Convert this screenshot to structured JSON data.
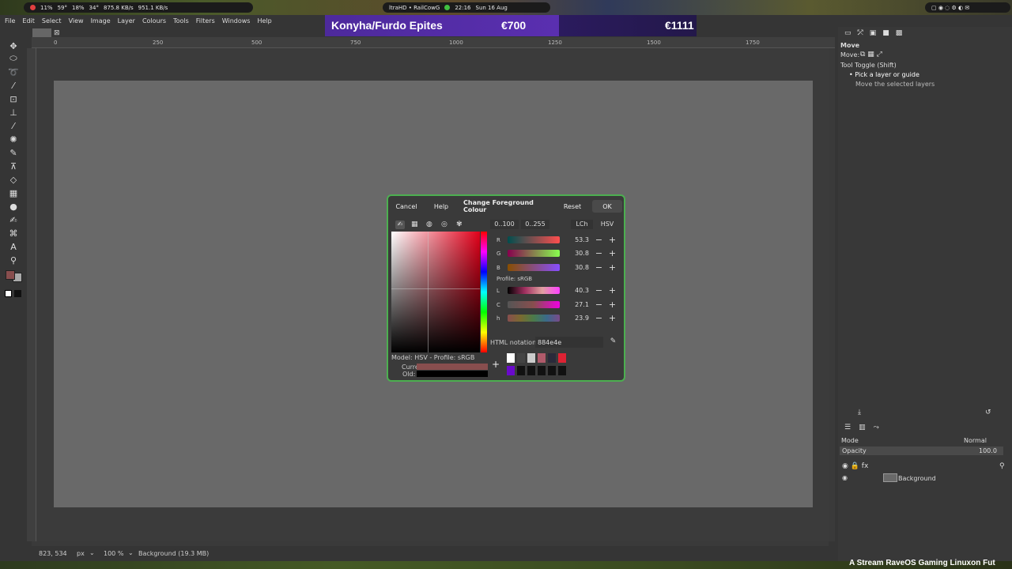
{
  "sysbar": {
    "cpu": "11%",
    "temp1": "59°",
    "mem": "18%",
    "temp2": "34°",
    "net_down": "875.8 KB/s",
    "net_up": "951.1 KB/s",
    "stream": "ltraHD • RailCowG",
    "time": "22:16",
    "date": "Sun 16 Aug"
  },
  "banner": {
    "left": "Konyha/Furdo Epites",
    "mid": "€700",
    "right": "€1111"
  },
  "menu": [
    "File",
    "Edit",
    "Select",
    "View",
    "Image",
    "Layer",
    "Colours",
    "Tools",
    "Filters",
    "Windows",
    "Help"
  ],
  "ruler": [
    "0",
    "250",
    "500",
    "750",
    "1000",
    "1250",
    "1500",
    "1750"
  ],
  "status": {
    "coords": "823, 534",
    "unit": "px",
    "zoom": "100 %",
    "info": "Background (19.3 MB)"
  },
  "dock": {
    "tool_title": "Move",
    "move_label": "Move:",
    "toggle_title": "Tool Toggle (Shift)",
    "opt1": "Pick a layer or guide",
    "opt2": "Move the selected layers",
    "mode_label": "Mode",
    "mode_value": "Normal",
    "opacity_label": "Opacity",
    "opacity_value": "100.0",
    "layer_name": "Background"
  },
  "dialog": {
    "cancel": "Cancel",
    "help": "Help",
    "title": "Change Foreground Colour",
    "reset": "Reset",
    "ok": "OK",
    "range1": "0..100",
    "range2": "0..255",
    "lch": "LCh",
    "hsv": "HSV",
    "rgb": [
      {
        "k": "R",
        "v": "53.3"
      },
      {
        "k": "G",
        "v": "30.8"
      },
      {
        "k": "B",
        "v": "30.8"
      }
    ],
    "profile": "Profile: sRGB",
    "lch_vals": [
      {
        "k": "L",
        "v": "40.3"
      },
      {
        "k": "C",
        "v": "27.1"
      },
      {
        "k": "h",
        "v": "23.9"
      }
    ],
    "html_label": "HTML notation:",
    "html_value": "884e4e",
    "model": "Model: HSV - Profile: sRGB",
    "current": "Current:",
    "old": "Old:",
    "history": [
      "#ffffff",
      "#444444",
      "#cccccc",
      "#b05a6a",
      "#2a2a3a",
      "#dd2233",
      "#6a0acc",
      "#111111",
      "#111111",
      "#111111",
      "#111111",
      "#111111"
    ]
  },
  "colors": {
    "current": "#884e4e",
    "old": "#000000",
    "fg": "#884e4e",
    "bg": "#aaaaaa"
  },
  "footer": "A Stream RaveOS Gaming Linuxon Fut"
}
